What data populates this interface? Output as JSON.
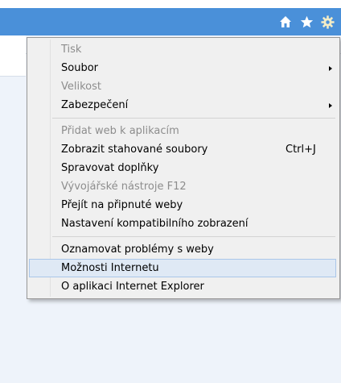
{
  "toolbar": {
    "icons": [
      "home-icon",
      "star-icon",
      "gear-icon"
    ],
    "accent_color": "#4a90d9"
  },
  "menu": {
    "items": [
      {
        "label": "Tisk",
        "disabled": true
      },
      {
        "label": "Soubor",
        "submenu": true
      },
      {
        "label": "Velikost",
        "disabled": true
      },
      {
        "label": "Zabezpečení",
        "submenu": true
      },
      {
        "label": "Přidat web k aplikacím",
        "disabled": true
      },
      {
        "label": "Zobrazit stahované soubory",
        "shortcut": "Ctrl+J"
      },
      {
        "label": "Spravovat doplňky"
      },
      {
        "label": "Vývojářské nástroje F12",
        "disabled": true
      },
      {
        "label": "Přejít na připnuté weby"
      },
      {
        "label": "Nastavení kompatibilního zobrazení"
      },
      {
        "label": "Oznamovat problémy s weby"
      },
      {
        "label": "Možnosti Internetu",
        "highlighted": true
      },
      {
        "label": "O aplikaci Internet Explorer"
      }
    ]
  }
}
